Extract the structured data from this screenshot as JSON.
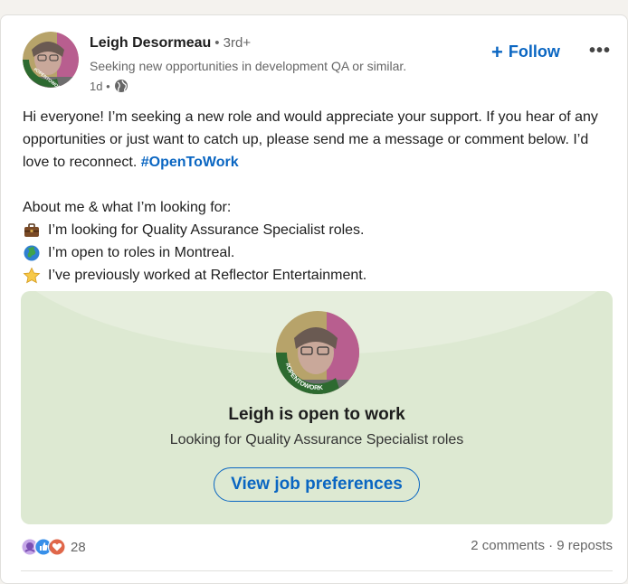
{
  "author": {
    "name": "Leigh Desormeau",
    "degree": "• 3rd+",
    "headline": "Seeking new opportunities in development QA or similar.",
    "time": "1d •",
    "badge_text": "#OPENTOWORK"
  },
  "actions": {
    "follow_label": "Follow",
    "more_label": "•••"
  },
  "post": {
    "intro": "Hi everyone! I’m seeking a new role and would appreciate your support. If you hear of any opportunities or just want to catch up, please send me a message or comment below. I’d love to reconnect. ",
    "hashtag": "#OpenToWork",
    "about_heading": "About me & what I’m looking for:",
    "items": [
      "I’m looking for Quality Assurance Specialist roles.",
      "I’m open to roles in Montreal.",
      "I’ve previously worked at Reflector Entertainment."
    ]
  },
  "open_to_work": {
    "title": "Leigh is open to work",
    "subtitle": "Looking for Quality Assurance Specialist roles",
    "button_label": "View job preferences",
    "badge_text": "#OPENTOWORK"
  },
  "social": {
    "reaction_count": "28",
    "comments": "2 comments",
    "separator": "·",
    "reposts": "9 reposts"
  },
  "colors": {
    "accent": "#0a66c2",
    "otw_green": "#2d6a30",
    "card_bg": "#dde9d2"
  }
}
